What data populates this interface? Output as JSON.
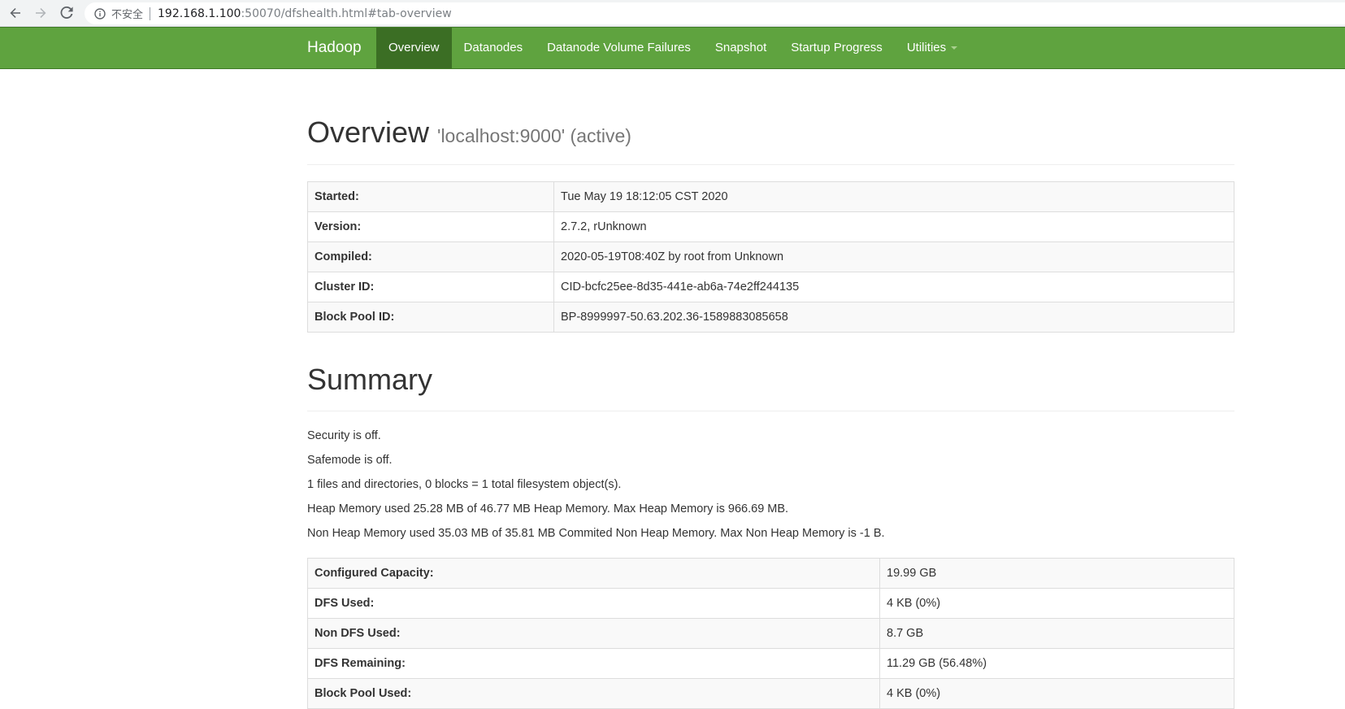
{
  "browser": {
    "security_label": "不安全",
    "url_host": "192.168.1.100",
    "url_rest": ":50070/dfshealth.html#tab-overview"
  },
  "navbar": {
    "brand": "Hadoop",
    "items": [
      {
        "label": "Overview",
        "active": true
      },
      {
        "label": "Datanodes"
      },
      {
        "label": "Datanode Volume Failures"
      },
      {
        "label": "Snapshot"
      },
      {
        "label": "Startup Progress"
      },
      {
        "label": "Utilities"
      }
    ],
    "colors": {
      "bar": "#5fa33f",
      "active": "#3b6e24"
    }
  },
  "overview": {
    "title": "Overview",
    "subtitle": "'localhost:9000' (active)",
    "rows": [
      {
        "key": "Started:",
        "value": "Tue May 19 18:12:05 CST 2020"
      },
      {
        "key": "Version:",
        "value": "2.7.2, rUnknown"
      },
      {
        "key": "Compiled:",
        "value": "2020-05-19T08:40Z by root from Unknown"
      },
      {
        "key": "Cluster ID:",
        "value": "CID-bcfc25ee-8d35-441e-ab6a-74e2ff244135"
      },
      {
        "key": "Block Pool ID:",
        "value": "BP-8999997-50.63.202.36-1589883085658"
      }
    ]
  },
  "summary": {
    "title": "Summary",
    "lines": [
      "Security is off.",
      "Safemode is off.",
      "1 files and directories, 0 blocks = 1 total filesystem object(s).",
      "Heap Memory used 25.28 MB of 46.77 MB Heap Memory. Max Heap Memory is 966.69 MB.",
      "Non Heap Memory used 35.03 MB of 35.81 MB Commited Non Heap Memory. Max Non Heap Memory is -1 B."
    ],
    "rows": [
      {
        "key": "Configured Capacity:",
        "value": "19.99 GB"
      },
      {
        "key": "DFS Used:",
        "value": "4 KB (0%)"
      },
      {
        "key": "Non DFS Used:",
        "value": "8.7 GB"
      },
      {
        "key": "DFS Remaining:",
        "value": "11.29 GB (56.48%)"
      },
      {
        "key": "Block Pool Used:",
        "value": "4 KB (0%)"
      }
    ]
  }
}
